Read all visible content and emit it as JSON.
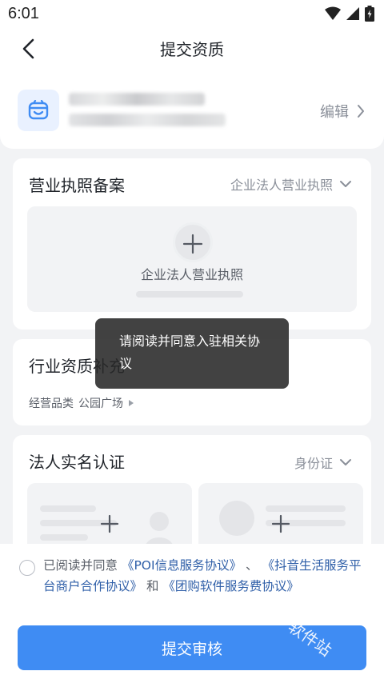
{
  "status_bar": {
    "time": "6:01"
  },
  "nav": {
    "title": "提交资质"
  },
  "store": {
    "edit_label": "编辑"
  },
  "license": {
    "title": "营业执照备案",
    "type_selected": "企业法人营业执照",
    "upload_label": "企业法人营业执照"
  },
  "industry": {
    "title": "行业资质补充",
    "category_label": "经营品类",
    "category_value": "公园广场"
  },
  "legal": {
    "title": "法人实名认证",
    "id_type_selected": "身份证"
  },
  "toast": {
    "message": "请阅读并同意入驻相关协议"
  },
  "agreement": {
    "prefix": "已阅读并同意",
    "link1": "《POI信息服务协议》",
    "sep1": "、",
    "link2": "《抖音生活服务平台商户合作协议》",
    "sep2": "和",
    "link3": "《团购软件服务费协议》"
  },
  "submit": {
    "label": "提交审核"
  },
  "watermark": {
    "text": "软件站"
  },
  "colors": {
    "primary": "#3f8cf3",
    "link": "#2f5fa8",
    "avatar_bg": "#e9f1ff"
  }
}
